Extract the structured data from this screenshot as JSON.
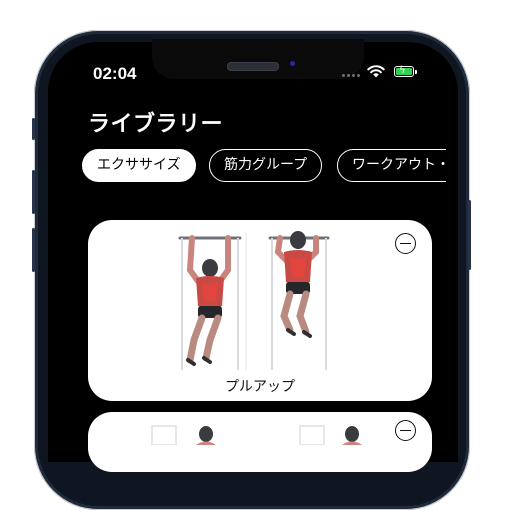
{
  "status_bar": {
    "time": "02:04"
  },
  "header": {
    "title": "ライブラリー"
  },
  "tabs": [
    {
      "label": "エクササイズ",
      "active": true
    },
    {
      "label": "筋力グループ",
      "active": false
    },
    {
      "label": "ワークアウト・",
      "active": false
    }
  ],
  "exercises": [
    {
      "name": "プルアップ",
      "icon": "minus-circle-icon"
    },
    {
      "name": "",
      "icon": "minus-circle-icon"
    }
  ],
  "colors": {
    "background": "#000000",
    "card": "#ffffff",
    "accent_muscle": "#d93a36",
    "battery": "#2fd34f"
  }
}
